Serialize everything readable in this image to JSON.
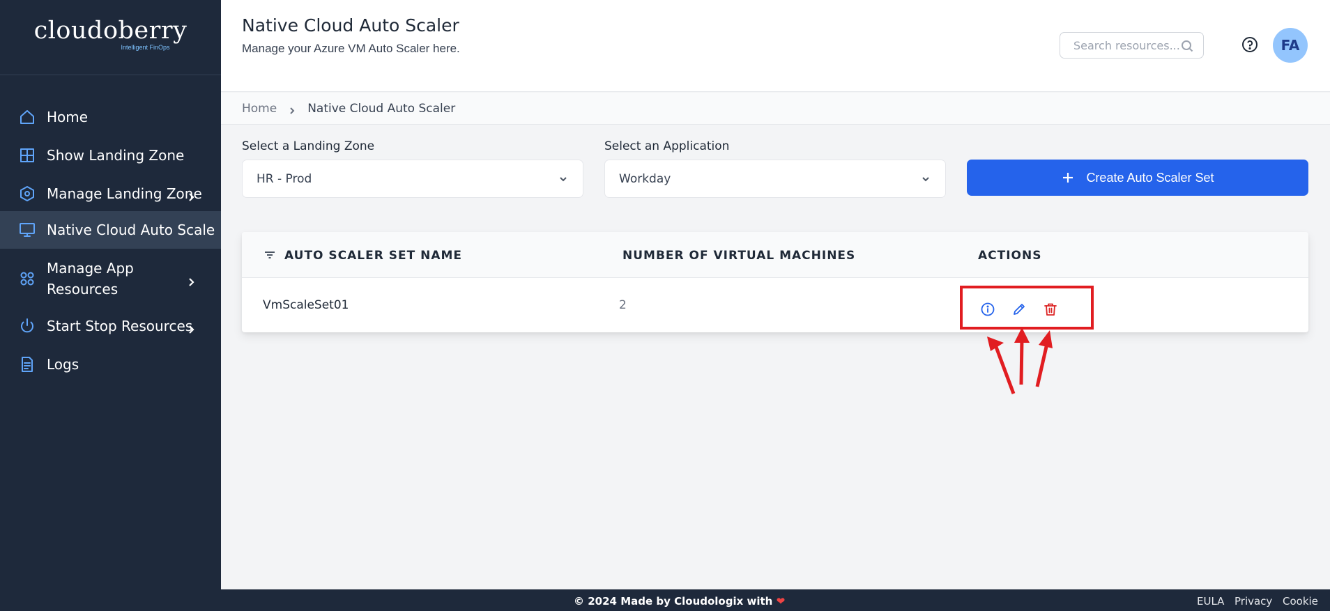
{
  "brand": {
    "name": "cloudoberry",
    "tagline": "Intelligent FinOps"
  },
  "sidebar": {
    "items": [
      {
        "label": "Home",
        "icon": "home-icon"
      },
      {
        "label": "Show Landing Zone",
        "icon": "grid-icon"
      },
      {
        "label": "Manage Landing Zone",
        "icon": "hexagon-settings-icon",
        "chevron": true
      },
      {
        "label": "Native Cloud Auto Scale",
        "icon": "monitor-icon",
        "active": true
      },
      {
        "label_line1": "Manage App",
        "label_line2": "Resources",
        "icon": "apps-icon",
        "chevron": true
      },
      {
        "label": "Start Stop Resources",
        "icon": "power-icon",
        "chevron": true
      },
      {
        "label": "Logs",
        "icon": "document-icon"
      }
    ]
  },
  "header": {
    "title": "Native Cloud Auto Scaler",
    "subtitle": "Manage your Azure VM Auto Scaler here.",
    "search_placeholder": "Search resources...",
    "avatar_initials": "FA"
  },
  "breadcrumb": {
    "home": "Home",
    "current": "Native Cloud Auto Scaler"
  },
  "filters": {
    "landing_zone_label": "Select a Landing Zone",
    "landing_zone_value": "HR - Prod",
    "application_label": "Select an Application",
    "application_value": "Workday"
  },
  "create_button_label": "Create Auto Scaler Set",
  "table": {
    "columns": [
      "AUTO SCALER SET NAME",
      "NUMBER OF VIRTUAL MACHINES",
      "ACTIONS"
    ],
    "rows": [
      {
        "name": "VmScaleSet01",
        "vm_count": "2"
      }
    ]
  },
  "footer": {
    "copyright": "© 2024 Made by Cloudologix with",
    "heart": "❤",
    "links": [
      "EULA",
      "Privacy",
      "Cookie"
    ]
  },
  "colors": {
    "sidebar_bg": "#1e293b",
    "accent": "#2563eb",
    "icon_blue": "#60a5fa",
    "delete_red": "#dc2626",
    "annotation_red": "#e11d21"
  }
}
